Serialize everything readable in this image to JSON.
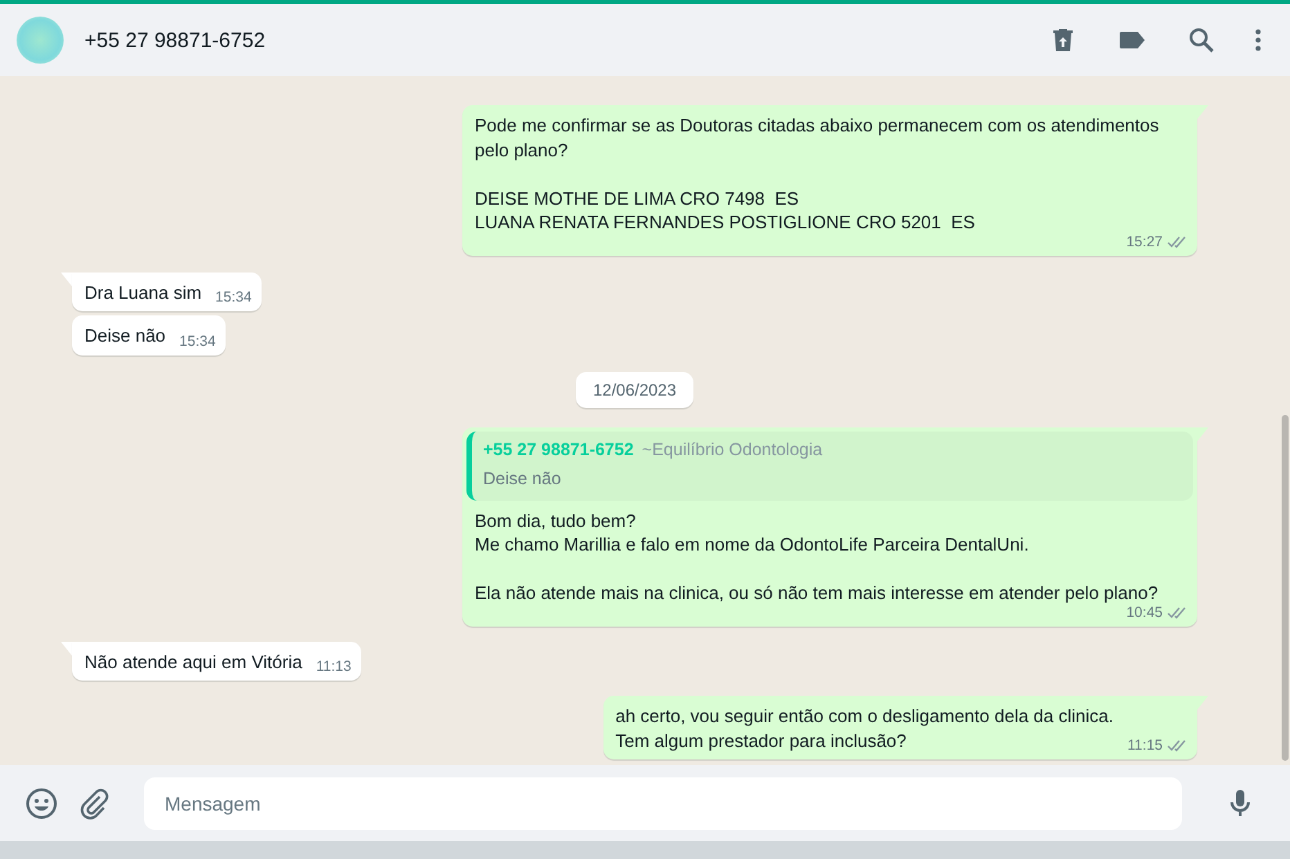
{
  "header": {
    "contact": "+55 27 98871-6752"
  },
  "messages": [
    {
      "kind": "outgoing",
      "text": "Pode me confirmar se as Doutoras citadas abaixo permanecem com os atendimentos pelo plano?\n\nDEISE MOTHE DE LIMA CRO 7498  ES\nLUANA RENATA FERNANDES POSTIGLIONE CRO 5201  ES",
      "time": "15:27",
      "read": false
    },
    {
      "kind": "incoming",
      "text": "Dra Luana sim",
      "time": "15:34",
      "tail": true
    },
    {
      "kind": "incoming",
      "text": "Deise não",
      "time": "15:34",
      "tail": false
    },
    {
      "kind": "date",
      "text": "12/06/2023"
    },
    {
      "kind": "outgoing",
      "quote": {
        "sender": "+55 27 98871-6752",
        "sender_name": "~Equilíbrio Odontologia",
        "text": "Deise não"
      },
      "text": "Bom dia, tudo bem?\nMe chamo Marillia e falo em nome da OdontoLife Parceira DentalUni.\n\nEla não atende mais na clinica, ou só não tem mais interesse em atender pelo plano?",
      "time": "10:45",
      "read": false
    },
    {
      "kind": "incoming",
      "text": "Não atende aqui em Vitória",
      "time": "11:13",
      "tail": true
    },
    {
      "kind": "outgoing",
      "text": "ah certo, vou seguir então com o desligamento dela da clinica.\nTem algum prestador para inclusão?",
      "time": "11:15",
      "read": false
    }
  ],
  "composer": {
    "placeholder": "Mensagem"
  }
}
